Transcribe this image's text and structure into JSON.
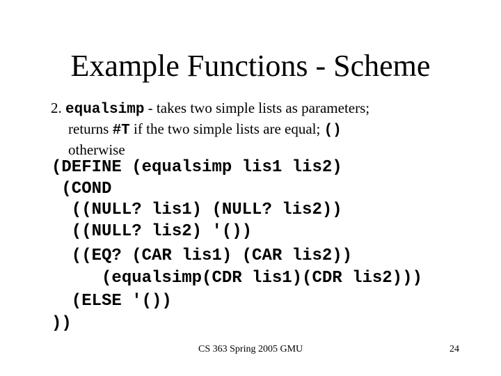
{
  "slide": {
    "title": "Example Functions - Scheme",
    "bullet": {
      "number": "2.",
      "function_name": "equalsimp",
      "line1_rest": " - takes two simple lists as parameters;",
      "line2_prefix": "returns ",
      "true_literal": "#T",
      "line2_mid": " if the two simple lists are equal; ",
      "empty_list_literal": "()",
      "line3": "otherwise"
    },
    "code_lines": [
      "(DEFINE (equalsimp lis1 lis2)",
      " (COND",
      "  ((NULL? lis1) (NULL? lis2))",
      "  ((NULL? lis2) '())",
      "  ((EQ? (CAR lis1) (CAR lis2))",
      "     (equalsimp(CDR lis1)(CDR lis2)))",
      "  (ELSE '())",
      "))"
    ],
    "footer": {
      "course": "CS 363 Spring 2005 GMU",
      "page_number": "24"
    }
  }
}
